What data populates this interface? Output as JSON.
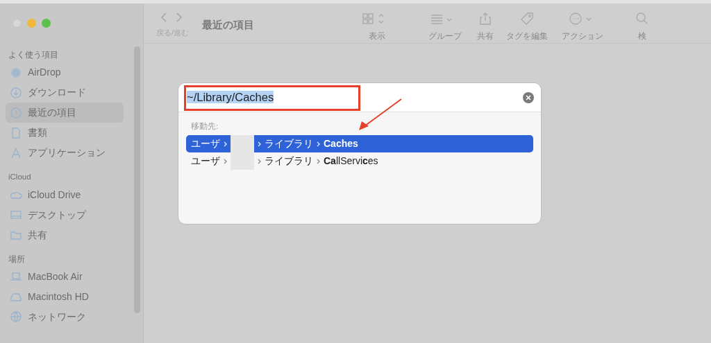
{
  "toolbar": {
    "nav_label": "戻る/進む",
    "title": "最近の項目",
    "items": [
      {
        "label": "表示"
      },
      {
        "label": "グループ"
      },
      {
        "label": "共有"
      },
      {
        "label": "タグを編集"
      },
      {
        "label": "アクション"
      },
      {
        "label": "検"
      }
    ]
  },
  "sidebar": {
    "sections": [
      {
        "heading": "よく使う項目",
        "items": [
          {
            "label": "AirDrop",
            "selected": false
          },
          {
            "label": "ダウンロード",
            "selected": false
          },
          {
            "label": "最近の項目",
            "selected": true
          },
          {
            "label": "書類",
            "selected": false
          },
          {
            "label": "アプリケーション",
            "selected": false
          }
        ]
      },
      {
        "heading": "iCloud",
        "items": [
          {
            "label": "iCloud Drive",
            "selected": false
          },
          {
            "label": "デスクトップ",
            "selected": false
          },
          {
            "label": "共有",
            "selected": false
          }
        ]
      },
      {
        "heading": "場所",
        "items": [
          {
            "label": "MacBook Air",
            "selected": false
          },
          {
            "label": "Macintosh HD",
            "selected": false
          },
          {
            "label": "ネットワーク",
            "selected": false
          }
        ]
      }
    ]
  },
  "go_to_folder": {
    "path_value": "~/Library/Caches",
    "section_label": "移動先:",
    "results": [
      {
        "selected": true,
        "segments": [
          {
            "kind": "folder",
            "text": "ユーザ"
          },
          {
            "kind": "redacted"
          },
          {
            "kind": "folder",
            "text": "ライブラリ"
          }
        ],
        "name": "Caches",
        "bold": true
      },
      {
        "selected": false,
        "segments": [
          {
            "kind": "folder",
            "text": "ユーザ"
          },
          {
            "kind": "redacted"
          },
          {
            "kind": "folder",
            "text": "ライブラリ"
          }
        ],
        "name": "**Ca**llServi**c**es",
        "bold": false
      }
    ]
  }
}
